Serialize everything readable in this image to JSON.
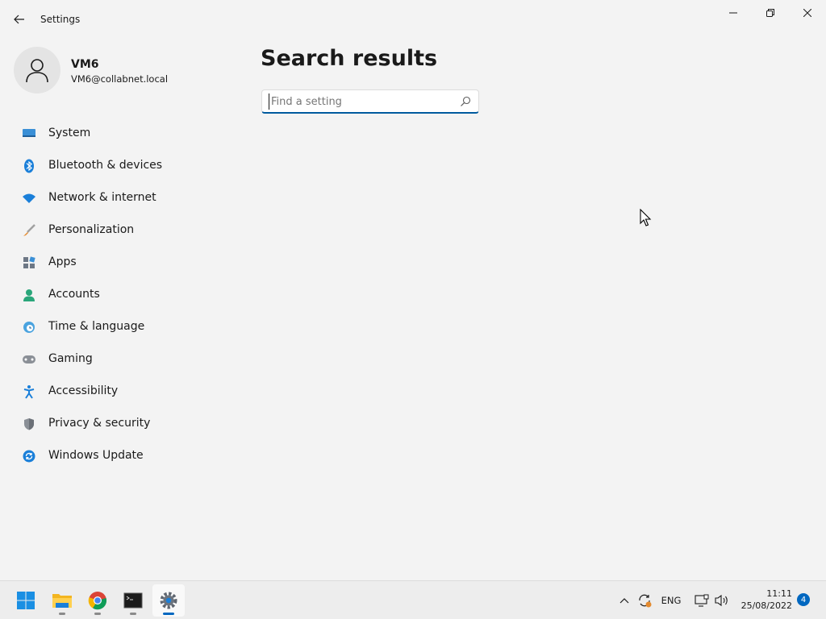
{
  "window": {
    "title": "Settings",
    "back_icon": "back-arrow-icon",
    "controls": [
      "minimize-icon",
      "maximize-icon",
      "close-icon"
    ]
  },
  "profile": {
    "name": "VM6",
    "email": "VM6@collabnet.local",
    "avatar_icon": "person-icon"
  },
  "sidebar": {
    "items": [
      {
        "label": "System",
        "icon": "display-icon"
      },
      {
        "label": "Bluetooth & devices",
        "icon": "bluetooth-icon"
      },
      {
        "label": "Network & internet",
        "icon": "wifi-icon"
      },
      {
        "label": "Personalization",
        "icon": "brush-icon"
      },
      {
        "label": "Apps",
        "icon": "apps-icon"
      },
      {
        "label": "Accounts",
        "icon": "person-icon"
      },
      {
        "label": "Time & language",
        "icon": "globe-clock-icon"
      },
      {
        "label": "Gaming",
        "icon": "gamepad-icon"
      },
      {
        "label": "Accessibility",
        "icon": "accessibility-icon"
      },
      {
        "label": "Privacy & security",
        "icon": "shield-icon"
      },
      {
        "label": "Windows Update",
        "icon": "update-icon"
      }
    ]
  },
  "main": {
    "title": "Search results",
    "search": {
      "placeholder": "Find a setting",
      "value": "",
      "icon": "search-icon"
    }
  },
  "taskbar": {
    "apps": [
      {
        "name": "Start",
        "icon": "windows-start-icon",
        "running": false
      },
      {
        "name": "File Explorer",
        "icon": "folder-icon",
        "running": true
      },
      {
        "name": "Google Chrome",
        "icon": "chrome-icon",
        "running": true
      },
      {
        "name": "Command Prompt",
        "icon": "terminal-icon",
        "running": true
      },
      {
        "name": "Settings",
        "icon": "gear-icon",
        "running": true,
        "active": true
      }
    ],
    "tray": {
      "language": "ENG",
      "time": "11:11",
      "date": "25/08/2022",
      "notifications": "4"
    }
  },
  "colors": {
    "background": "#f3f3f3",
    "accent": "#0067c0",
    "taskbar": "#ededed"
  }
}
